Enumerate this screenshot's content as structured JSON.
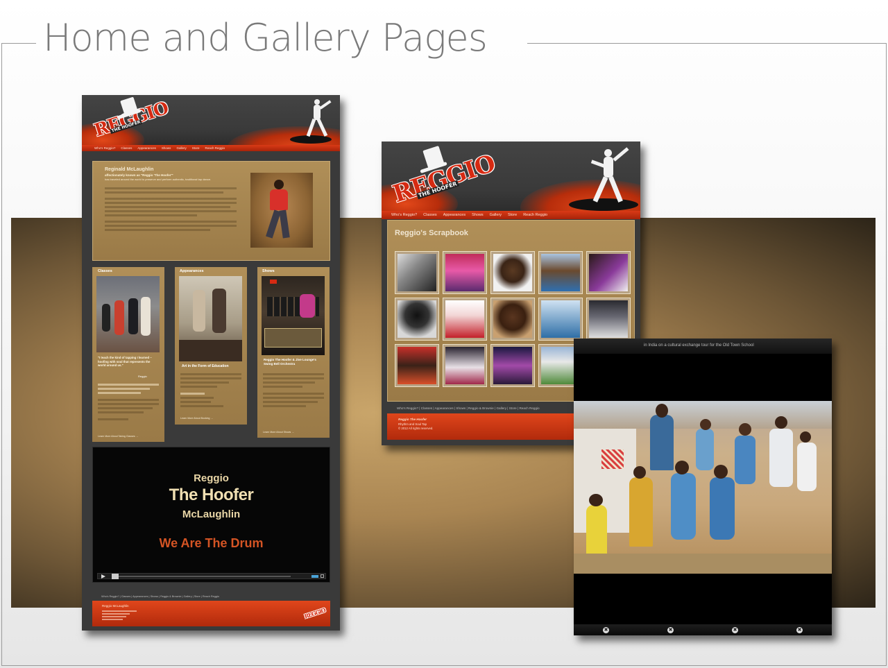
{
  "slide": {
    "title": "Home and Gallery Pages"
  },
  "home": {
    "nav": [
      "Who's Reggio?",
      "Classes",
      "Appearances",
      "Shows",
      "Gallery",
      "Store",
      "Reach Reggio"
    ],
    "intro_name": "Reginald McLaughlin",
    "intro_alias": "affectionately known as \"Reggio 'The Hoofer'\"",
    "intro_desc": "has traveled around the world to preserve and perform authentic, traditional tap dance.",
    "col_classes": "Classes",
    "col_appearances": "Appearances",
    "col_shows": "Shows",
    "classes_quote": "\"I teach the kind of tapping I learned – hoofing with soul that represents the world around us.\"",
    "classes_attrib": "Reggio",
    "appearances_caption": "Art in the Form of Education",
    "shows_caption": "Reggio The Hoofer & Jive Lounge's Swing Bell Orchestra",
    "classes_link": "Learn More About Taking Classes →",
    "appearances_link": "Learn More About Booking →",
    "shows_link": "Learn More About Shows →",
    "video_line1": "Reggio",
    "video_line2": "The Hoofer",
    "video_line3": "McLaughlin",
    "video_line4": "We Are The Drum",
    "footer_links": "Who's Reggio? | Classes | Appearances | Shows | Reggio & Brownie | Gallery | Store | Reach Reggio",
    "footer_name": "Reggio McLaughlin"
  },
  "gallery": {
    "nav": [
      "Who's Reggio?",
      "Classes",
      "Appearances",
      "Shows",
      "Gallery",
      "Store",
      "Reach Reggio"
    ],
    "heading": "Reggio's Scrapbook",
    "footer_links": "Who's Reggio? | Classes | Appearances | Shows | Reggio & Brownie | Gallery | Store | Reach Reggio",
    "footer_line1": "Reggio The Hoofer",
    "footer_line2": "Rhythm and Soul Tap",
    "footer_line3": "© 2012 All rights reserved."
  },
  "logo": {
    "word": "REGGIO",
    "sub": "THE HOOFER"
  },
  "lightbox": {
    "caption": "in India on a cultural exchange tour for the Old Town School"
  },
  "colors": {
    "accent_red": "#d62a12",
    "gold": "#a98552",
    "dark": "#3a3a3a"
  },
  "icons": {
    "play": "play-icon",
    "close": "close-icon"
  }
}
